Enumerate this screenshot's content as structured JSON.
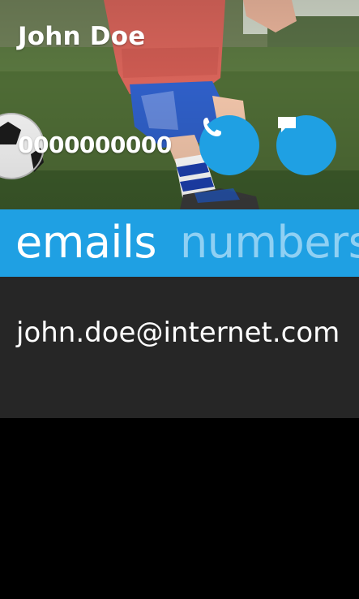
{
  "contact": {
    "name": "John Doe",
    "phone": "0000000000",
    "email": "john.doe@internet.com"
  },
  "actions": {
    "call_icon": "phone-icon",
    "message_icon": "message-icon"
  },
  "tabs": [
    {
      "label": "emails",
      "selected": true
    },
    {
      "label": "numbers",
      "selected": false
    }
  ],
  "colors": {
    "accent": "#1fa0e3",
    "inactive_tab": "#8fd0f3",
    "panel": "#262626",
    "background": "#000000",
    "text": "#ffffff"
  }
}
